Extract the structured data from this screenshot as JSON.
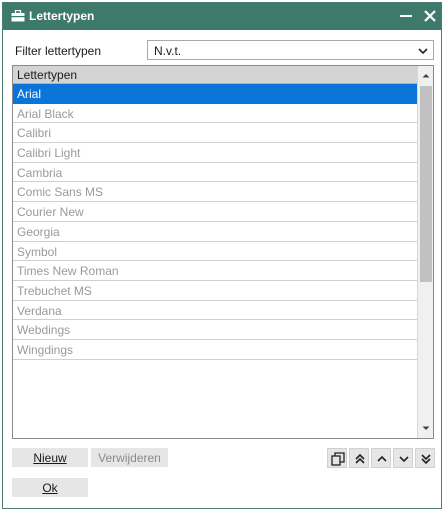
{
  "window": {
    "title": "Lettertypen",
    "accent_color": "#3e7a6b",
    "title_icon": "toolbox-icon",
    "minimize_icon": "minimize-icon",
    "close_icon": "close-icon"
  },
  "filter": {
    "label": "Filter lettertypen",
    "value": "N.v.t."
  },
  "list": {
    "header": "Lettertypen",
    "selected_color": "#0a74d8",
    "selected_index": 0,
    "items": [
      "Arial",
      "Arial Black",
      "Calibri",
      "Calibri Light",
      "Cambria",
      "Comic Sans MS",
      "Courier New",
      "Georgia",
      "Symbol",
      "Times New Roman",
      "Trebuchet MS",
      "Verdana",
      "Webdings",
      "Wingdings"
    ]
  },
  "buttons": {
    "new_label": "Nieuw",
    "delete_label": "Verwijderen",
    "ok_label": "Ok"
  },
  "toolbar_icons": [
    "copy-icon",
    "move-top-icon",
    "move-up-icon",
    "move-down-icon",
    "move-bottom-icon"
  ]
}
